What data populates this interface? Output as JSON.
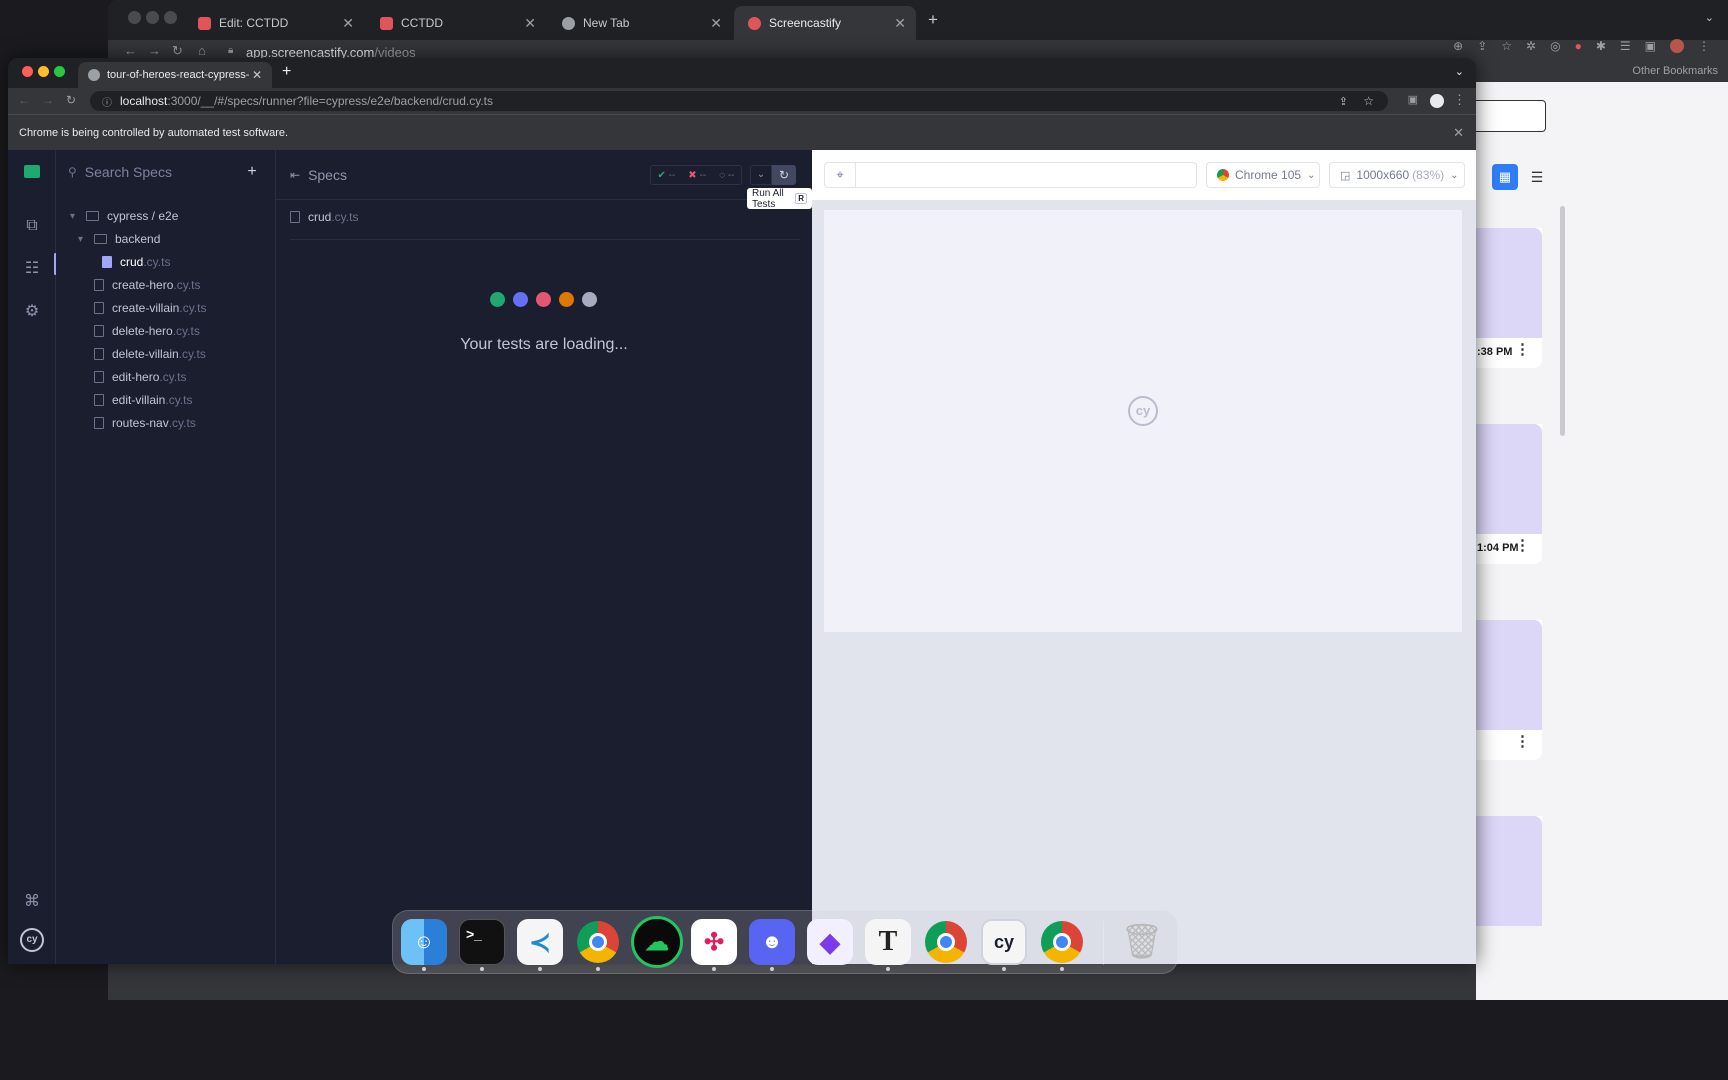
{
  "background_browser": {
    "tabs": [
      {
        "label": "Edit: CCTDD",
        "fav_color": "#e0555a"
      },
      {
        "label": "CCTDD",
        "fav_color": "#e0555a"
      },
      {
        "label": "New Tab",
        "fav_color": "#9aa0a6"
      },
      {
        "label": "Screencastify",
        "fav_color": "#e0555a"
      }
    ],
    "url_host": "app.screencastify.com",
    "url_path": "/videos",
    "bookmarks_label": "Other Bookmarks",
    "cards": [
      {
        "time": ":38 PM"
      },
      {
        "time": "1:04 PM"
      },
      {
        "time": ""
      },
      {
        "time": ""
      }
    ]
  },
  "browser": {
    "tab_title": "tour-of-heroes-react-cypress-",
    "url_host": "localhost",
    "url_rest": ":3000/__/#/specs/runner?file=cypress/e2e/backend/crud.cy.ts",
    "infobar_text": "Chrome is being controlled by automated test software."
  },
  "cypress": {
    "search_placeholder": "Search Specs",
    "tree": {
      "root_folder": "cypress / e2e",
      "sub_folder": "backend",
      "active_file": {
        "name": "crud",
        "ext": ".cy.ts"
      },
      "files": [
        {
          "name": "create-hero",
          "ext": ".cy.ts"
        },
        {
          "name": "create-villain",
          "ext": ".cy.ts"
        },
        {
          "name": "delete-hero",
          "ext": ".cy.ts"
        },
        {
          "name": "delete-villain",
          "ext": ".cy.ts"
        },
        {
          "name": "edit-hero",
          "ext": ".cy.ts"
        },
        {
          "name": "edit-villain",
          "ext": ".cy.ts"
        },
        {
          "name": "routes-nav",
          "ext": ".cy.ts"
        }
      ]
    },
    "reporter": {
      "title": "Specs",
      "stats": {
        "passed": "--",
        "failed": "--",
        "pending": "--"
      },
      "tooltip": "Run All Tests",
      "tooltip_key": "R",
      "spec_name": "crud",
      "spec_ext": ".cy.ts",
      "loading_text": "Your tests are loading...",
      "dot_colors": [
        "#1fa971",
        "#6470f3",
        "#e45770",
        "#db7903",
        "#a8abbf"
      ]
    },
    "aut": {
      "browser_label": "Chrome 105",
      "viewport_label": "1000x660",
      "viewport_scale": "(83%)",
      "logo_text": "cy"
    }
  },
  "dock": {
    "apps": [
      "finder",
      "terminal",
      "vscode",
      "chrome",
      "screencastify",
      "slack",
      "discord",
      "obsidian",
      "typora",
      "chrome",
      "cypress",
      "chrome",
      "trash"
    ]
  }
}
